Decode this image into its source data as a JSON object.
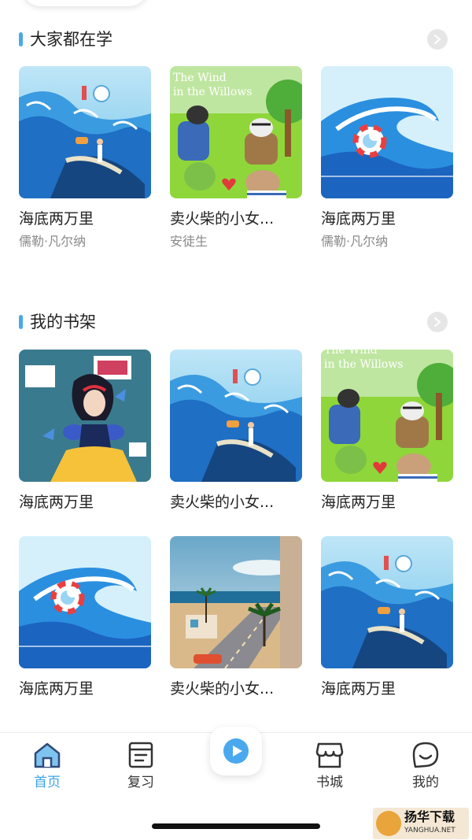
{
  "sections": [
    {
      "title": "大家都在学",
      "books": [
        {
          "title": "海底两万里",
          "author": "儒勒·凡尔纳",
          "cover": "ocean-ship"
        },
        {
          "title": "卖火柴的小女...",
          "author": "安徒生",
          "cover": "wind-willows"
        },
        {
          "title": "海底两万里",
          "author": "儒勒·凡尔纳",
          "cover": "wave-lifebuoy"
        }
      ]
    },
    {
      "title": "我的书架",
      "books": [
        {
          "title": "海底两万里",
          "cover": "snow-white"
        },
        {
          "title": "卖火柴的小女...",
          "cover": "ocean-ship"
        },
        {
          "title": "海底两万里",
          "cover": "wind-willows"
        },
        {
          "title": "海底两万里",
          "cover": "wave-lifebuoy"
        },
        {
          "title": "卖火柴的小女...",
          "cover": "beach-street"
        },
        {
          "title": "海底两万里",
          "cover": "ocean-ship"
        }
      ]
    }
  ],
  "cover_text": {
    "wind_willows_line1": "The Wind",
    "wind_willows_line2": "in the Willows"
  },
  "tabbar": {
    "items": [
      {
        "label": "首页",
        "icon": "home-icon",
        "active": true
      },
      {
        "label": "复习",
        "icon": "review-icon",
        "active": false
      },
      {
        "label": "",
        "icon": "play-icon",
        "active": false
      },
      {
        "label": "书城",
        "icon": "store-icon",
        "active": false
      },
      {
        "label": "我的",
        "icon": "profile-icon",
        "active": false
      }
    ]
  },
  "watermark": {
    "name": "扬华下载",
    "url": "YANGHUA.NET"
  },
  "colors": {
    "accent": "#3aa3e6",
    "section_bar": "#4aa8e8",
    "author_gray": "#8a8a8a"
  }
}
